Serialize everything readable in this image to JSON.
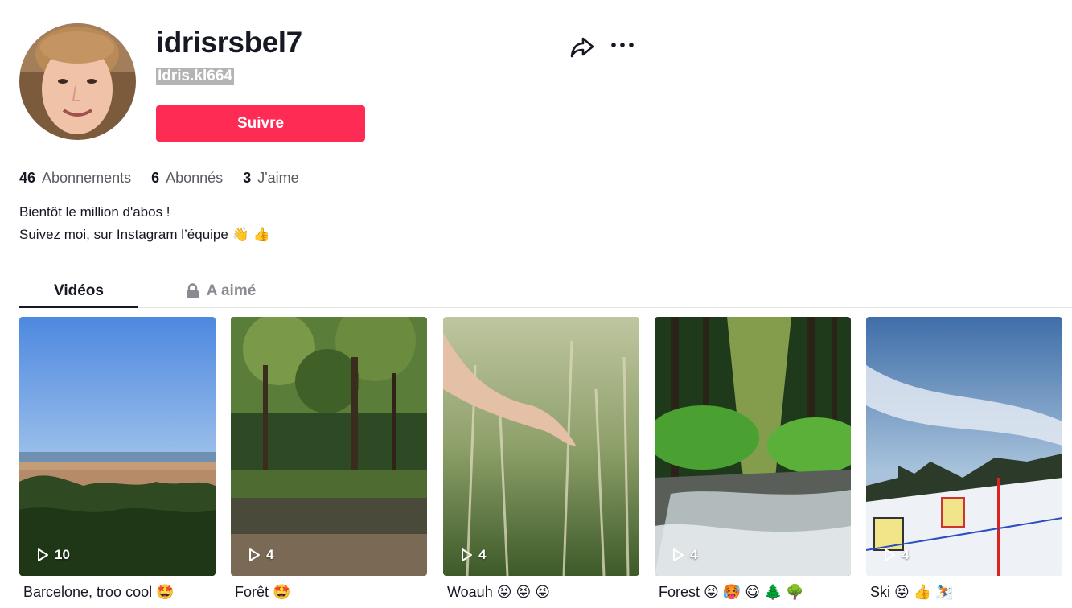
{
  "profile": {
    "username": "idrisrsbel7",
    "nickname": "Idris.kl664",
    "follow_label": "Suivre",
    "bio_line1": "Bientôt le million d'abos !",
    "bio_line2": "Suivez moi, sur Instagram l’équipe 👋 👍"
  },
  "stats": [
    {
      "value": "46",
      "label": "Abonnements"
    },
    {
      "value": "6",
      "label": "Abonnés"
    },
    {
      "value": "3",
      "label": "J'aime"
    }
  ],
  "tabs": [
    {
      "label": "Vidéos",
      "active": true
    },
    {
      "label": "A aimé",
      "icon": "lock-icon"
    }
  ],
  "icons": {
    "share": "share-icon",
    "more": "more-icon",
    "play": "play-icon"
  },
  "colors": {
    "accent": "#fe2c55",
    "text": "#161823",
    "muted": "#8a8b91"
  },
  "videos": [
    {
      "views": "10",
      "caption": "Barcelone, troo cool 🤩"
    },
    {
      "views": "4",
      "caption": "Forêt 🤩"
    },
    {
      "views": "4",
      "caption": "Woauh 😝 😝 😝"
    },
    {
      "views": "4",
      "caption": "Forest 😝 🥵 😋 🌲 🌳"
    },
    {
      "views": "4",
      "caption": "Ski 😝 👍 ⛷️"
    }
  ]
}
